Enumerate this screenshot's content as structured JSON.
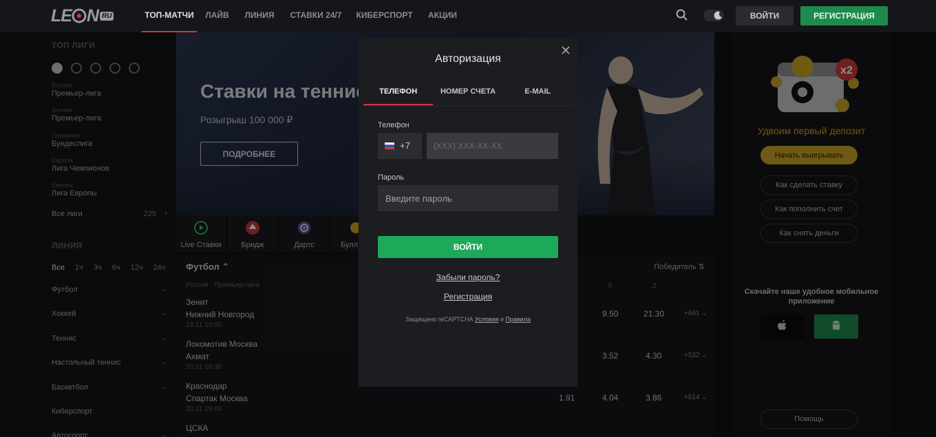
{
  "header": {
    "logo_text": "LE",
    "logo_text2": "N",
    "logo_badge": "RU",
    "nav": [
      "ТОП-МАТЧИ",
      "ЛАЙВ",
      "ЛИНИЯ",
      "СТАВКИ 24/7",
      "КИБЕРСПОРТ",
      "АКЦИИ"
    ],
    "login_label": "ВОЙТИ",
    "register_label": "РЕГИСТРАЦИЯ"
  },
  "sidebar": {
    "top_leagues_title": "ТОП ЛИГИ",
    "leagues": [
      {
        "country": "Россия",
        "name": "Премьер-лига"
      },
      {
        "country": "Англия",
        "name": "Премьер-лига"
      },
      {
        "country": "Германия",
        "name": "Бундеслига"
      },
      {
        "country": "Европа",
        "name": "Лига Чемпионов"
      },
      {
        "country": "Европа",
        "name": "Лига Европы"
      }
    ],
    "all_leagues_label": "Все лиги",
    "all_leagues_count": "225",
    "line_title": "ЛИНИЯ",
    "time_filters": [
      "Все",
      "1ч",
      "3ч",
      "6ч",
      "12ч",
      "24ч"
    ],
    "sports": [
      "Футбол",
      "Хоккей",
      "Теннис",
      "Настольный теннис",
      "Баскетбол",
      "Киберспорт",
      "Автоспорт"
    ]
  },
  "banner": {
    "title": "Ставки на теннис",
    "subtitle": "Розыгрыш 100 000 ₽",
    "button": "ПОДРОБНЕЕ"
  },
  "sport_tabs": [
    "Live Ставки",
    "Бридж",
    "Дартс",
    "Булл"
  ],
  "matches": {
    "sport": "Футбол",
    "filter": "Победитель",
    "league": "Россия · Премьер-лига",
    "odds_headers": [
      "X",
      "2"
    ],
    "rows": [
      {
        "team1": "Зенит",
        "team2": "Нижний Новгород",
        "date": "19.11 19:00",
        "o1": "",
        "ox": "9.50",
        "o2": "21.30",
        "more": "+661"
      },
      {
        "team1": "Локомотив Москва",
        "team2": "Ахмат",
        "date": "20.11 16:30",
        "o1": "",
        "ox": "3.52",
        "o2": "4.30",
        "more": "+532"
      },
      {
        "team1": "Краснодар",
        "team2": "Спартак Москва",
        "date": "20.11 19:00",
        "o1": "1.91",
        "ox": "4.04",
        "o2": "3.86",
        "more": "+514"
      },
      {
        "team1": "ЦСКА",
        "team2": "",
        "date": "",
        "o1": "",
        "ox": "",
        "o2": "",
        "more": ""
      }
    ]
  },
  "right_panel": {
    "promo_title": "Удвоим первый депозит",
    "promo_button": "Начать выигрывать",
    "help_links": [
      "Как сделать ставку",
      "Как пополнить счет",
      "Как снять деньги"
    ],
    "app_title": "Скачайте наше удобное мобильное приложение",
    "help_button": "Помощь",
    "wallet_badge": "x2"
  },
  "modal": {
    "title": "Авторизация",
    "tabs": [
      "ТЕЛЕФОН",
      "НОМЕР СЧЕТА",
      "E-MAIL"
    ],
    "phone_label": "Телефон",
    "phone_code": "+7",
    "phone_placeholder": "(XXX) XXX-XX-XX",
    "password_label": "Пароль",
    "password_placeholder": "Введите пароль",
    "submit_label": "ВОЙТИ",
    "forgot_label": "Забыли пароль?",
    "register_label": "Регистрация",
    "captcha_prefix": "Защищено reCAPTCHA",
    "captcha_terms": "Условия",
    "captcha_and": "и",
    "captcha_privacy": "Правила"
  },
  "colors": {
    "accent_red": "#d0393b",
    "green": "#1ea85a",
    "gold": "#c9a227"
  }
}
